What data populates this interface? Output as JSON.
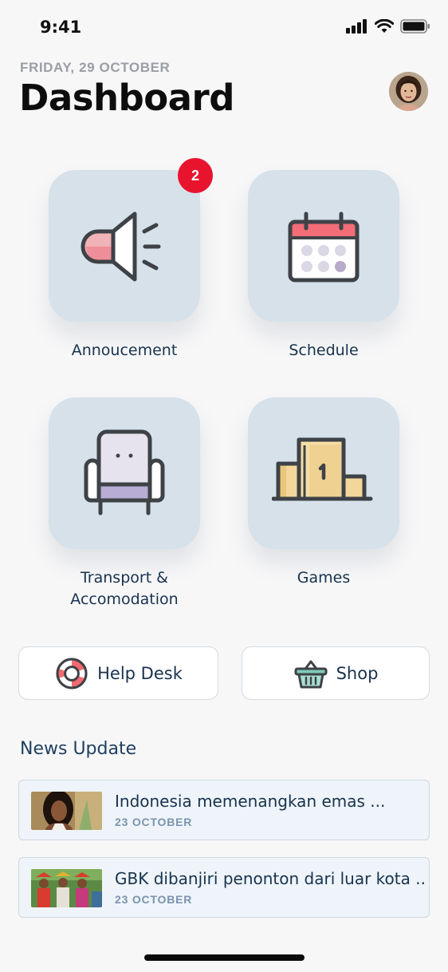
{
  "status_bar": {
    "time": "9:41"
  },
  "header": {
    "date": "FRIDAY, 29 OCTOBER",
    "title": "Dashboard"
  },
  "tiles": [
    {
      "label": "Annoucement",
      "icon": "megaphone-icon",
      "badge": "2"
    },
    {
      "label": "Schedule",
      "icon": "calendar-icon"
    },
    {
      "label": "Transport &\nAccomodation",
      "icon": "armchair-icon"
    },
    {
      "label": "Games",
      "icon": "podium-icon"
    }
  ],
  "actions": {
    "help_desk": {
      "label": "Help Desk",
      "icon": "lifebuoy-icon"
    },
    "shop": {
      "label": "Shop",
      "icon": "basket-icon"
    }
  },
  "news": {
    "title": "News Update",
    "items": [
      {
        "title": "Indonesia memenangkan emas ...",
        "date": "23 OCTOBER"
      },
      {
        "title": "GBK dibanjiri penonton dari luar kota ...",
        "date": "23 OCTOBER"
      }
    ]
  },
  "colors": {
    "tile_bg": "#d6e1ea",
    "badge": "#e8142e",
    "news_bg": "#eef4f9",
    "text_dark": "#18324e"
  }
}
